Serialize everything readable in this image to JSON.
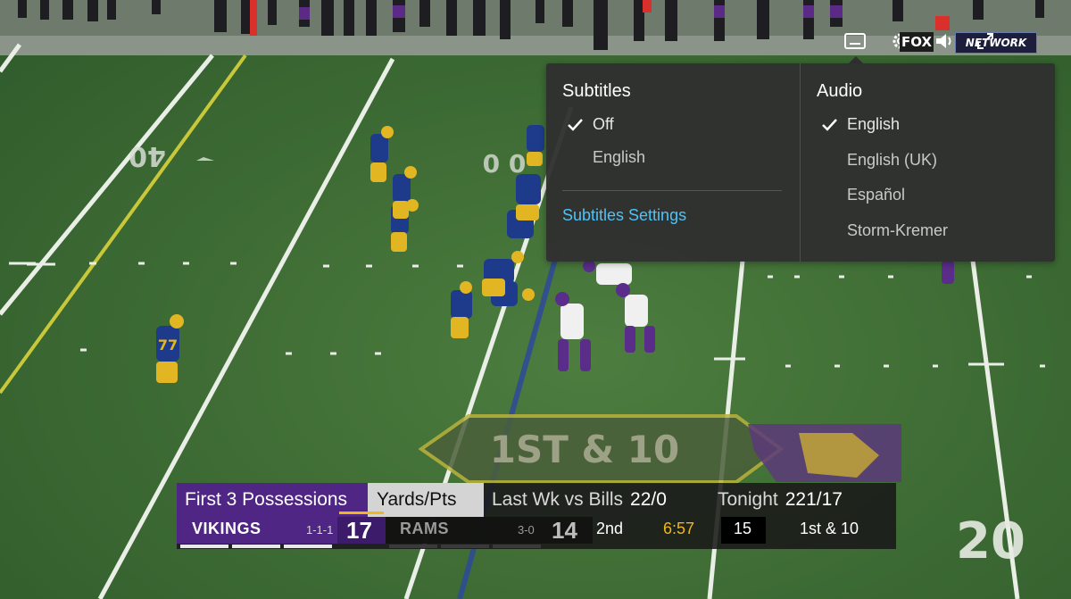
{
  "player_controls": {
    "subtitles_icon": "subtitles-icon",
    "network_logo_text": "FOX",
    "network_logo_suffix": "NETWORK",
    "settings_icon": "gear-icon",
    "volume_icon": "speaker-icon",
    "fullscreen_icon": "fullscreen-icon"
  },
  "menu": {
    "subtitles": {
      "heading": "Subtitles",
      "options": [
        {
          "label": "Off",
          "selected": true
        },
        {
          "label": "English",
          "selected": false
        }
      ],
      "settings_link": "Subtitles Settings"
    },
    "audio": {
      "heading": "Audio",
      "options": [
        {
          "label": "English",
          "selected": true
        },
        {
          "label": "English (UK)",
          "selected": false
        },
        {
          "label": "Español",
          "selected": false
        },
        {
          "label": "Storm-Kremer",
          "selected": false
        }
      ]
    }
  },
  "field": {
    "yard_marker_left": "40",
    "yard_marker_right": "20",
    "down_graphic": "1ST & 10",
    "jersey_near_player": "77",
    "sideline_sign_number": "20"
  },
  "scorebug": {
    "stat_title": "First 3 Possessions",
    "stat_metric": "Yards/Pts",
    "stat_last_week_label": "Last Wk vs Bills",
    "stat_last_week_value": "22/0",
    "stat_tonight_label": "Tonight",
    "stat_tonight_value": "221/17",
    "home_team": "VIKINGS",
    "home_record": "1-1-1",
    "home_score": "17",
    "away_team": "RAMS",
    "away_record": "3-0",
    "away_score": "14",
    "quarter": "2nd",
    "game_clock": "6:57",
    "play_clock": "15",
    "down_distance": "1st & 10"
  },
  "colors": {
    "vikings_purple": "#4f2683",
    "vikings_gold": "#f2b51d",
    "link_blue": "#4fc3f7",
    "menu_bg": "#303030"
  }
}
